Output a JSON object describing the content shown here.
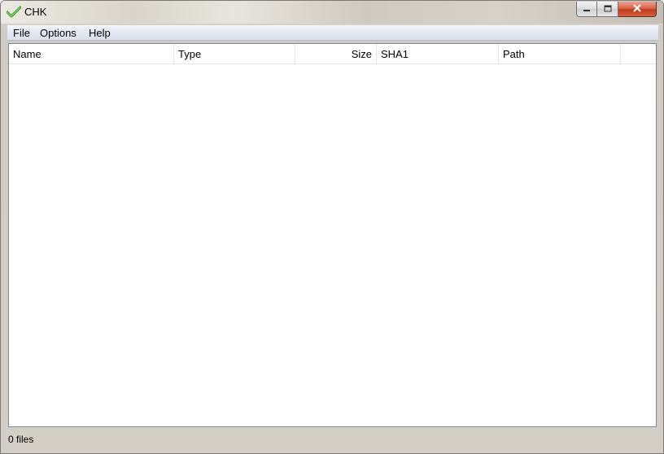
{
  "window": {
    "title": "CHK",
    "icon": "green-checkmark-icon",
    "caption_buttons": [
      "minimize-icon",
      "maximize-icon",
      "close-icon"
    ],
    "close_color": "#c2381a"
  },
  "menu": {
    "items": [
      "File",
      "Options",
      "Help"
    ]
  },
  "list": {
    "columns": [
      "Name",
      "Type",
      "Size",
      "SHA1",
      "Path"
    ],
    "rows": []
  },
  "status": {
    "text": "0 files"
  }
}
